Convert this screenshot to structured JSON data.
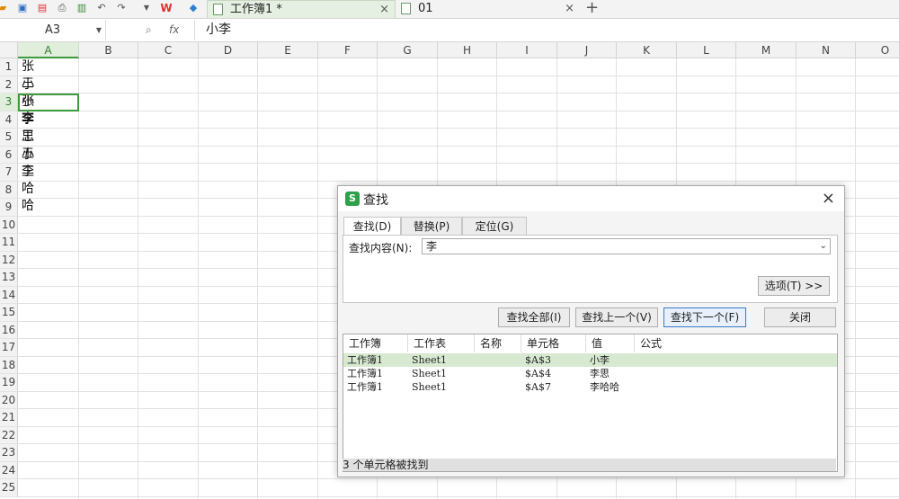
{
  "toolbar": {
    "icons": [
      "open-icon",
      "save-icon",
      "export-pdf-icon",
      "print-icon",
      "print-preview-icon",
      "undo-icon",
      "redo-icon",
      "more-icon",
      "wps-logo-icon",
      "cloud-cube-icon"
    ]
  },
  "tabs": [
    {
      "label": "工作簿1 *",
      "close": "×"
    },
    {
      "label": "01",
      "close": "×"
    }
  ],
  "new_tab": "+",
  "formula_bar": {
    "name_box": "A3",
    "fx": "fx",
    "value": "小李"
  },
  "columns": [
    "A",
    "B",
    "C",
    "D",
    "E",
    "F",
    "G",
    "H",
    "I",
    "J",
    "K",
    "L",
    "M",
    "N",
    "O"
  ],
  "rows": [
    "1",
    "2",
    "3",
    "4",
    "5",
    "6",
    "7",
    "8",
    "9",
    "10",
    "11",
    "12",
    "13",
    "14",
    "15",
    "16",
    "17",
    "18",
    "19",
    "20",
    "21",
    "22",
    "23",
    "24",
    "25"
  ],
  "cells": [
    "张三",
    "小张",
    "小李",
    "李思",
    "王五",
    "小王",
    "李哈哈"
  ],
  "selected_cell": "A3",
  "dialog": {
    "title": "查找",
    "close": "×",
    "tabs": [
      "查找(D)",
      "替换(P)",
      "定位(G)"
    ],
    "find_label": "查找内容(N):",
    "find_value": "李",
    "options_button": "选项(T) >>",
    "buttons": {
      "find_all": "查找全部(I)",
      "find_prev": "查找上一个(V)",
      "find_next": "查找下一个(F)",
      "close": "关闭"
    },
    "result_columns": [
      "工作簿",
      "工作表",
      "名称",
      "单元格",
      "值",
      "公式"
    ],
    "results": [
      {
        "book": "工作簿1",
        "sheet": "Sheet1",
        "name": "",
        "cell": "$A$3",
        "value": "小李",
        "formula": ""
      },
      {
        "book": "工作簿1",
        "sheet": "Sheet1",
        "name": "",
        "cell": "$A$4",
        "value": "李思",
        "formula": ""
      },
      {
        "book": "工作簿1",
        "sheet": "Sheet1",
        "name": "",
        "cell": "$A$7",
        "value": "李哈哈",
        "formula": ""
      }
    ],
    "status": "3 个单元格被找到"
  }
}
